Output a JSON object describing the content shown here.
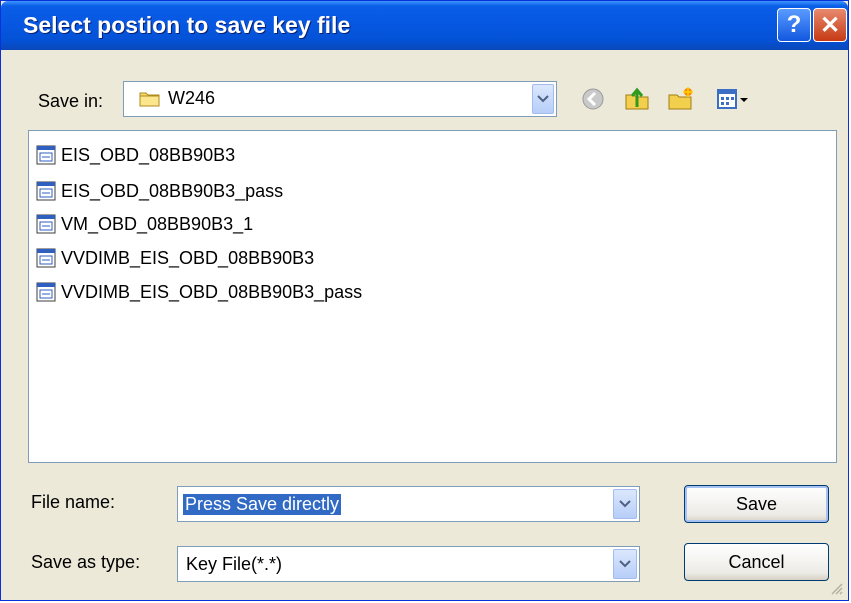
{
  "window": {
    "title": "Select postion to save key file",
    "help_glyph": "?",
    "close_glyph": "✕"
  },
  "save_in": {
    "label": "Save in:",
    "value": "W246",
    "icons": [
      "folder-icon",
      "back-icon",
      "up-folder-icon",
      "new-folder-icon",
      "views-menu-icon"
    ]
  },
  "files": [
    {
      "name": "EIS_OBD_08BB90B3",
      "icon": "file-icon"
    },
    {
      "name": "EIS_OBD_08BB90B3_pass",
      "icon": "file-icon"
    },
    {
      "name": "VM_OBD_08BB90B3_1",
      "icon": "file-icon"
    },
    {
      "name": "VVDIMB_EIS_OBD_08BB90B3",
      "icon": "file-icon"
    },
    {
      "name": "VVDIMB_EIS_OBD_08BB90B3_pass",
      "icon": "file-icon"
    }
  ],
  "file_name": {
    "label": "File name:",
    "value": "Press Save directly"
  },
  "save_as_type": {
    "label": "Save as type:",
    "value": "Key File(*.*)"
  },
  "buttons": {
    "save": "Save",
    "cancel": "Cancel"
  },
  "colors": {
    "titlebar": "#0352d6",
    "selection": "#316ac5",
    "dialog_bg": "#ece9d8"
  }
}
